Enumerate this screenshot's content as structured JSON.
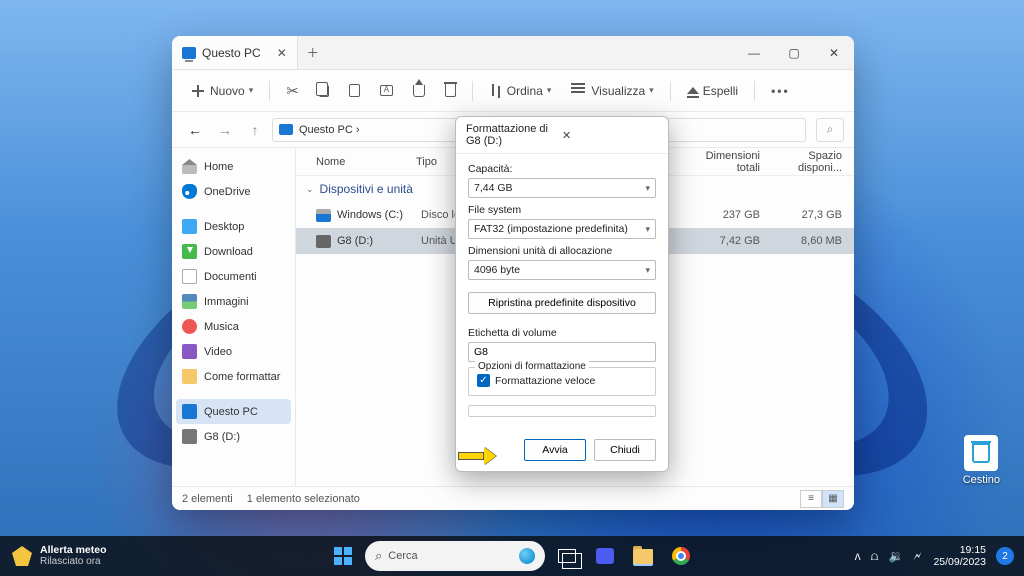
{
  "window": {
    "tab_title": "Questo PC",
    "toolbar": {
      "nuovo": "Nuovo",
      "ordina": "Ordina",
      "visualizza": "Visualizza",
      "espelli": "Espelli"
    },
    "breadcrumb": "Questo PC  ›",
    "columns": {
      "nome": "Nome",
      "tipo": "Tipo",
      "dim": "Dimensioni totali",
      "disp": "Spazio disponi..."
    },
    "group": "Dispositivi e unità",
    "drives": [
      {
        "name": "Windows (C:)",
        "type": "Disco locale",
        "size": "237 GB",
        "free": "27,3 GB"
      },
      {
        "name": "G8 (D:)",
        "type": "Unità USB",
        "size": "7,42 GB",
        "free": "8,60 MB"
      }
    ],
    "status": {
      "count": "2 elementi",
      "sel": "1 elemento selezionato"
    }
  },
  "sidebar": {
    "home": "Home",
    "onedrive": "OneDrive",
    "desktop": "Desktop",
    "download": "Download",
    "documenti": "Documenti",
    "immagini": "Immagini",
    "musica": "Musica",
    "video": "Video",
    "come": "Come formattar",
    "questopc": "Questo PC",
    "g8": "G8 (D:)"
  },
  "dialog": {
    "title": "Formattazione di G8 (D:)",
    "cap_lbl": "Capacità:",
    "cap_val": "7,44 GB",
    "fs_lbl": "File system",
    "fs_val": "FAT32 (impostazione predefinita)",
    "au_lbl": "Dimensioni unità di allocazione",
    "au_val": "4096 byte",
    "restore": "Ripristina predefinite dispositivo",
    "vol_lbl": "Etichetta di volume",
    "vol_val": "G8",
    "opt_lbl": "Opzioni di formattazione",
    "quick": "Formattazione veloce",
    "avvia": "Avvia",
    "chiudi": "Chiudi"
  },
  "desktop": {
    "cestino": "Cestino"
  },
  "taskbar": {
    "wx_title": "Allerta meteo",
    "wx_sub": "Rilasciato ora",
    "search_ph": "Cerca",
    "time": "19:15",
    "date": "25/09/2023",
    "notif_count": "2"
  }
}
